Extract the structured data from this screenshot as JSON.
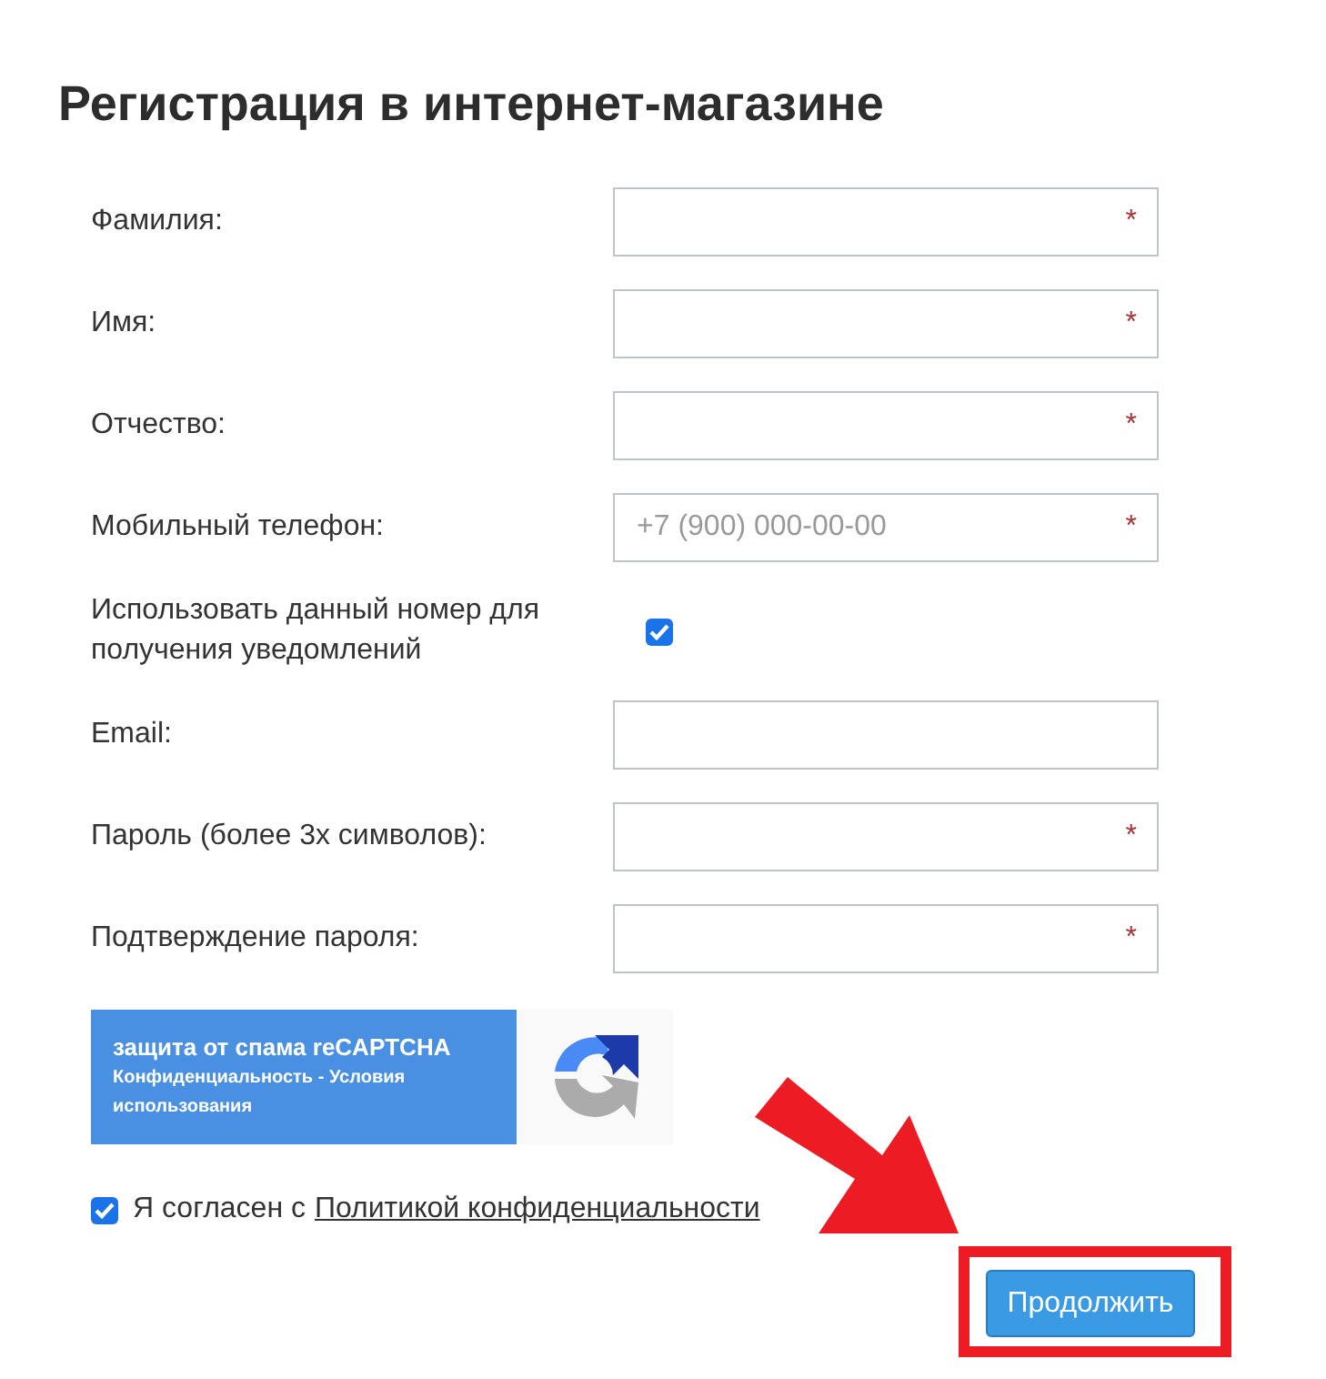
{
  "title": "Регистрация в интернет-магазине",
  "fields": [
    {
      "kind": "field",
      "label": "Фамилия:",
      "required_mark": "*"
    },
    {
      "kind": "field",
      "label": "Имя:",
      "required_mark": "*"
    },
    {
      "kind": "field",
      "label": "Отчество:",
      "required_mark": "*"
    },
    {
      "kind": "field",
      "label": "Мобильный телефон:",
      "required_mark": "*",
      "placeholder": "+7 (900) 000-00-00"
    },
    {
      "kind": "checkbox",
      "label": "Использовать данный номер для получения уведомлений",
      "checked": true
    },
    {
      "kind": "field",
      "label": "Email:"
    },
    {
      "kind": "field",
      "label": "Пароль (более 3х символов):",
      "required_mark": "*"
    },
    {
      "kind": "field",
      "label": "Подтверждение пароля:",
      "required_mark": "*"
    }
  ],
  "recaptcha": {
    "title": "защита от спама reCAPTCHA",
    "links": "Конфиденциальность - Условия использования"
  },
  "agreement": {
    "checked": true,
    "text": "Я согласен с",
    "link": "Политикой конфиденциальности"
  },
  "submit": "Продолжить"
}
